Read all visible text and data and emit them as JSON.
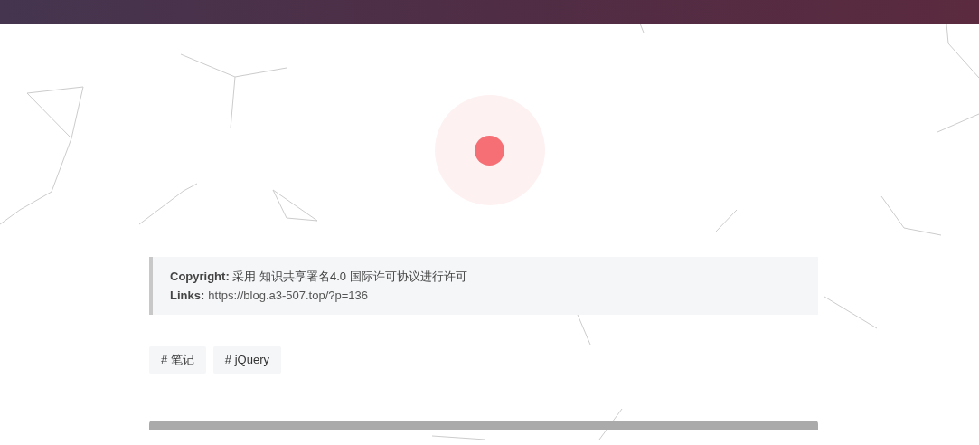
{
  "copyright": {
    "label": "Copyright:",
    "text": "采用 知识共享署名4.0 国际许可协议进行许可"
  },
  "links": {
    "label": "Links:",
    "url": "https://blog.a3-507.top/?p=136"
  },
  "tags": [
    "# 笔记",
    "# jQuery"
  ]
}
